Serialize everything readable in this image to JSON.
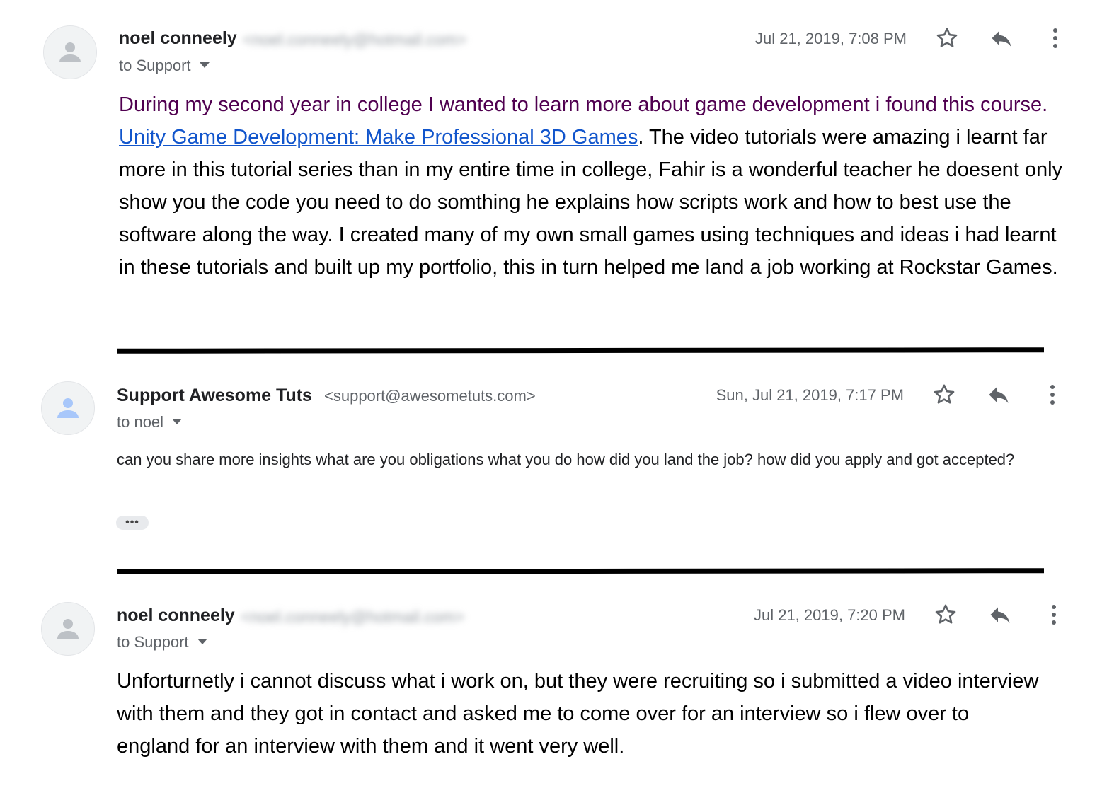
{
  "messages": [
    {
      "sender_name": "noel conneely",
      "sender_email": "<noel.conneely@hotmail.com>",
      "recipient": "to Support",
      "date": "Jul 21, 2019, 7:08 PM",
      "body_intro": "During my second year in college I wanted to learn more about game development i found this course.",
      "body_link": "Unity Game Development: Make Professional 3D Games",
      "body_rest": ". The video tutorials were  amazing i learnt far more in this tutorial series than in my entire time in college, Fahir is a wonderful teacher he doesent only show you the code you need to do somthing he explains how scripts work and how to best use the software along the way. I created many of my own small games using techniques and ideas i had learnt in these tutorials and built up my portfolio, this in turn helped me land a job working at Rockstar Games."
    },
    {
      "sender_name": "Support Awesome Tuts",
      "sender_email": "<support@awesometuts.com>",
      "recipient": "to noel",
      "date": "Sun, Jul 21, 2019, 7:17 PM",
      "body": "can you share more insights what are you obligations what you do how did you land the job? how did you apply and got accepted?",
      "trimmed_content": "•••"
    },
    {
      "sender_name": "noel conneely",
      "sender_email": "<noel.conneely@hotmail.com>",
      "recipient": "to Support",
      "date": "Jul 21, 2019, 7:20 PM",
      "body": "Unforturnetly i cannot discuss what i work on, but they were recruiting so i submitted a video interview with them and they got in contact and asked me to come over for an interview so i flew over to england for an interview with them and it went very well."
    }
  ],
  "icons": {
    "avatar": "person-icon",
    "star": "star-icon",
    "reply": "reply-icon",
    "more": "more-vert-icon"
  },
  "colors": {
    "link": "#1155cc",
    "quoted_purple": "#500050",
    "avatar_gray": "#bdc1c6",
    "avatar_blue": "#a8c7fa",
    "meta_gray": "#5f6368",
    "divider": "#000000"
  }
}
